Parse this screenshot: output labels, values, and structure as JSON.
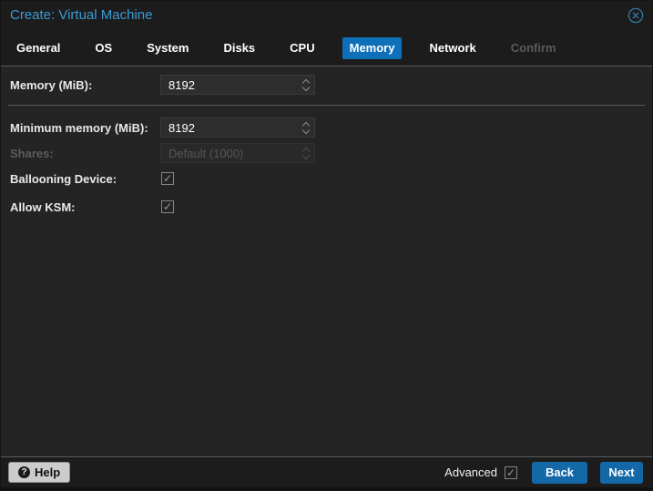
{
  "window": {
    "title": "Create: Virtual Machine"
  },
  "tabs": [
    {
      "label": "General",
      "state": "normal"
    },
    {
      "label": "OS",
      "state": "normal"
    },
    {
      "label": "System",
      "state": "normal"
    },
    {
      "label": "Disks",
      "state": "normal"
    },
    {
      "label": "CPU",
      "state": "normal"
    },
    {
      "label": "Memory",
      "state": "active"
    },
    {
      "label": "Network",
      "state": "normal"
    },
    {
      "label": "Confirm",
      "state": "disabled"
    }
  ],
  "form": {
    "memory": {
      "label": "Memory (MiB):",
      "value": "8192",
      "enabled": true
    },
    "min_memory": {
      "label": "Minimum memory (MiB):",
      "value": "8192",
      "enabled": true
    },
    "shares": {
      "label": "Shares:",
      "value": "Default (1000)",
      "enabled": false
    },
    "ballooning_device": {
      "label": "Ballooning Device:",
      "checked": true
    },
    "allow_ksm": {
      "label": "Allow KSM:",
      "checked": true
    }
  },
  "footer": {
    "help_label": "Help",
    "advanced_label": "Advanced",
    "advanced_checked": true,
    "back_label": "Back",
    "next_label": "Next"
  },
  "icons": {
    "check": "✓",
    "help_qmark": "?"
  },
  "colors": {
    "accent_button_blue": "#1468a8",
    "active_tab_blue": "#0e70b8",
    "title_blue": "#3c9bd5",
    "dialog_background": "#242424",
    "header_background": "#1c1c1c"
  }
}
